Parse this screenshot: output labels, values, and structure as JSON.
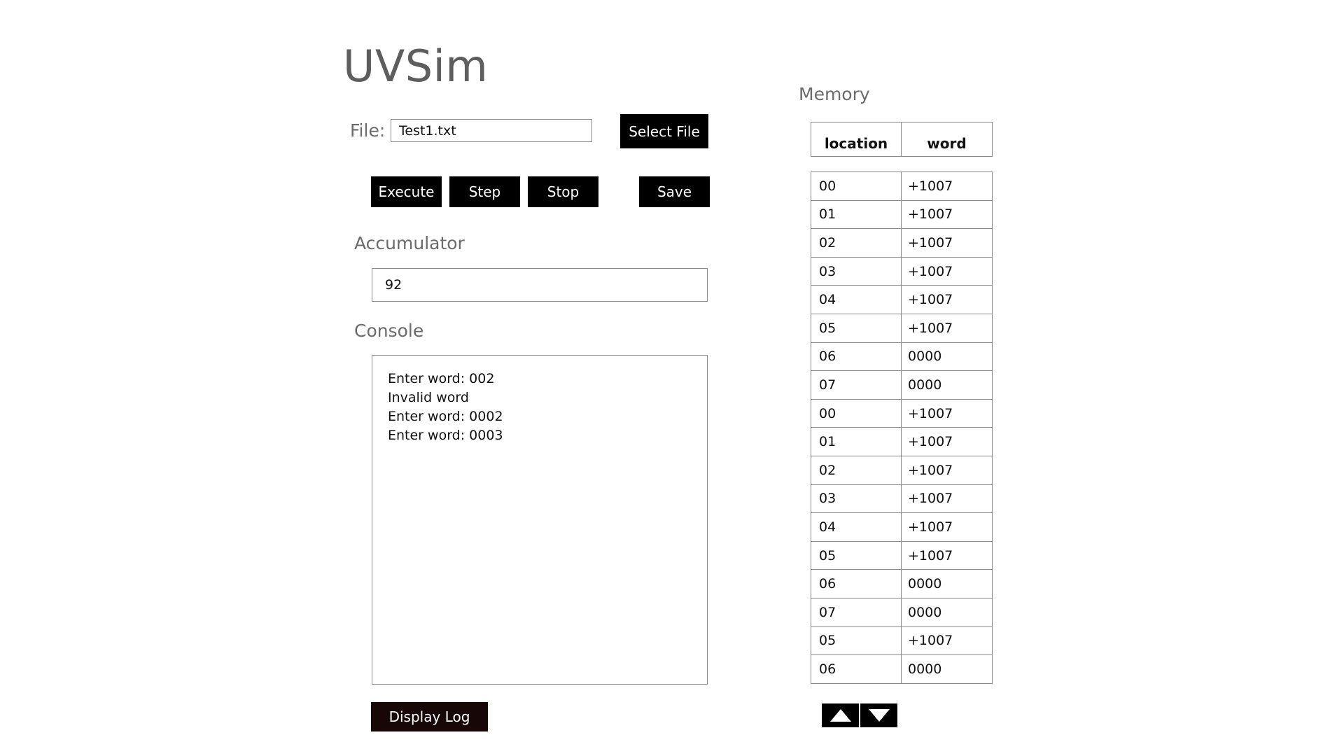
{
  "app": {
    "title": "UVSim"
  },
  "file": {
    "label": "File:",
    "value": "Test1.txt",
    "select_label": "Select File"
  },
  "controls": {
    "execute": "Execute",
    "step": "Step",
    "stop": "Stop",
    "save": "Save"
  },
  "accumulator": {
    "label": "Accumulator",
    "value": "92"
  },
  "console": {
    "label": "Console",
    "lines": [
      "Enter word: 002",
      "Invalid word",
      "Enter word: 0002",
      "Enter word: 0003"
    ]
  },
  "display_log": {
    "label": "Display Log"
  },
  "memory": {
    "label": "Memory",
    "headers": {
      "location": "location",
      "word": "word"
    },
    "rows": [
      {
        "location": "00",
        "word": "+1007"
      },
      {
        "location": "01",
        "word": "+1007"
      },
      {
        "location": "02",
        "word": "+1007"
      },
      {
        "location": "03",
        "word": "+1007"
      },
      {
        "location": "04",
        "word": "+1007"
      },
      {
        "location": "05",
        "word": "+1007"
      },
      {
        "location": "06",
        "word": "0000"
      },
      {
        "location": "07",
        "word": "0000"
      },
      {
        "location": "00",
        "word": "+1007"
      },
      {
        "location": "01",
        "word": "+1007"
      },
      {
        "location": "02",
        "word": "+1007"
      },
      {
        "location": "03",
        "word": "+1007"
      },
      {
        "location": "04",
        "word": "+1007"
      },
      {
        "location": "05",
        "word": "+1007"
      },
      {
        "location": "06",
        "word": "0000"
      },
      {
        "location": "07",
        "word": "0000"
      },
      {
        "location": "05",
        "word": "+1007"
      },
      {
        "location": "06",
        "word": "0000"
      }
    ],
    "scroll_up_icon": "triangle-up-icon",
    "scroll_down_icon": "triangle-down-icon"
  }
}
